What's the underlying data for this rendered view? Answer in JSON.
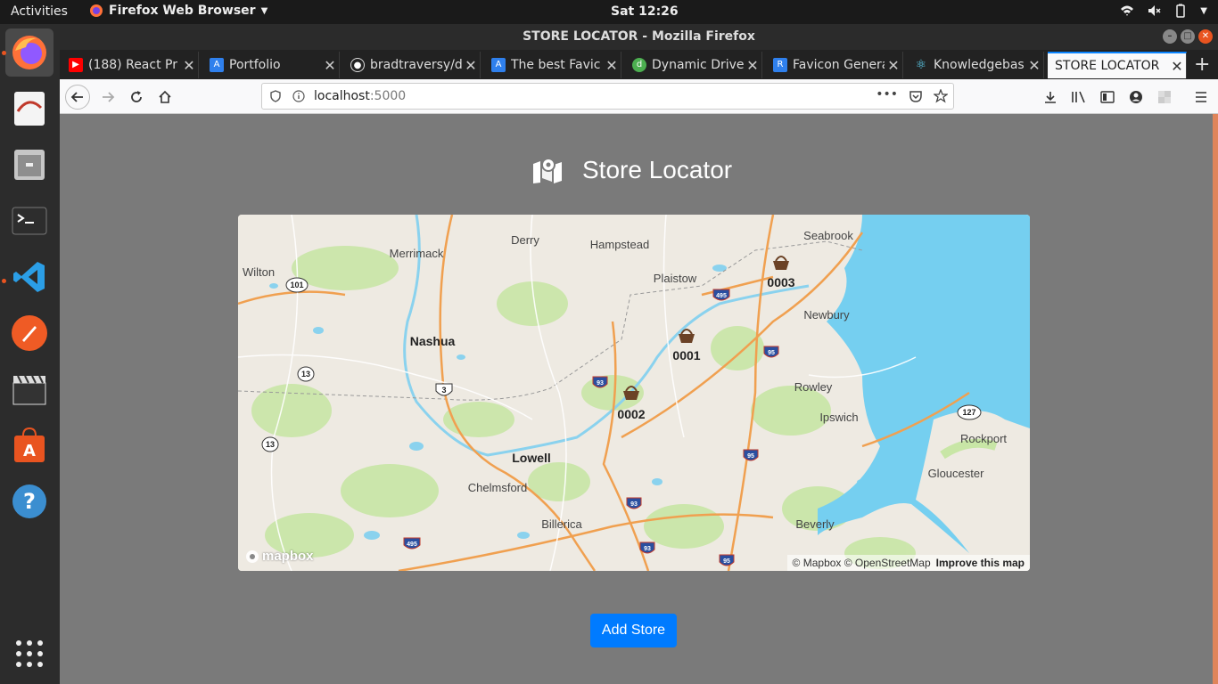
{
  "topbar": {
    "activities": "Activities",
    "app_name": "Firefox Web Browser",
    "clock": "Sat 12:26"
  },
  "window": {
    "title": "STORE LOCATOR - Mozilla Firefox"
  },
  "tabs": [
    {
      "title": "(188) React Pr",
      "icon": "youtube-icon",
      "color": "#ff0000"
    },
    {
      "title": "Portfolio",
      "icon": "a-letter-icon",
      "color": "#2f80ed"
    },
    {
      "title": "bradtraversy/d",
      "icon": "github-icon",
      "color": "#ffffff"
    },
    {
      "title": "The best Favic",
      "icon": "a-letter-icon",
      "color": "#2f80ed"
    },
    {
      "title": "Dynamic Drive",
      "icon": "dd-icon",
      "color": "#4caf50"
    },
    {
      "title": "Favicon Genera",
      "icon": "r-letter-icon",
      "color": "#2f80ed"
    },
    {
      "title": "Knowledgebas",
      "icon": "react-icon",
      "color": "#61dafb"
    },
    {
      "title": "STORE LOCATOR",
      "icon": "",
      "color": ""
    }
  ],
  "url": {
    "host": "localhost",
    "port": ":5000"
  },
  "page": {
    "heading": "Store Locator",
    "add_button": "Add Store"
  },
  "map": {
    "stores": [
      {
        "id": "0001"
      },
      {
        "id": "0002"
      },
      {
        "id": "0003"
      }
    ],
    "places": [
      "Derry",
      "Hampstead",
      "Seabrook",
      "Merrimack",
      "Wilton",
      "Plaistow",
      "Newbury",
      "Nashua",
      "Rowley",
      "Ipswich",
      "Rockport",
      "Lowell",
      "Chelmsford",
      "Gloucester",
      "Billerica",
      "Beverly"
    ],
    "shields": [
      "101",
      "13",
      "3",
      "93",
      "495",
      "95",
      "127"
    ],
    "attribution": "© Mapbox © OpenStreetMap",
    "improve": "Improve this map",
    "logo": "mapbox"
  },
  "colors": {
    "water": "#75cff0",
    "land": "#eeeae2",
    "green": "#c8e6a6",
    "highway": "#f0a050",
    "button": "#007bff",
    "ubuntu_accent": "#e95420"
  }
}
